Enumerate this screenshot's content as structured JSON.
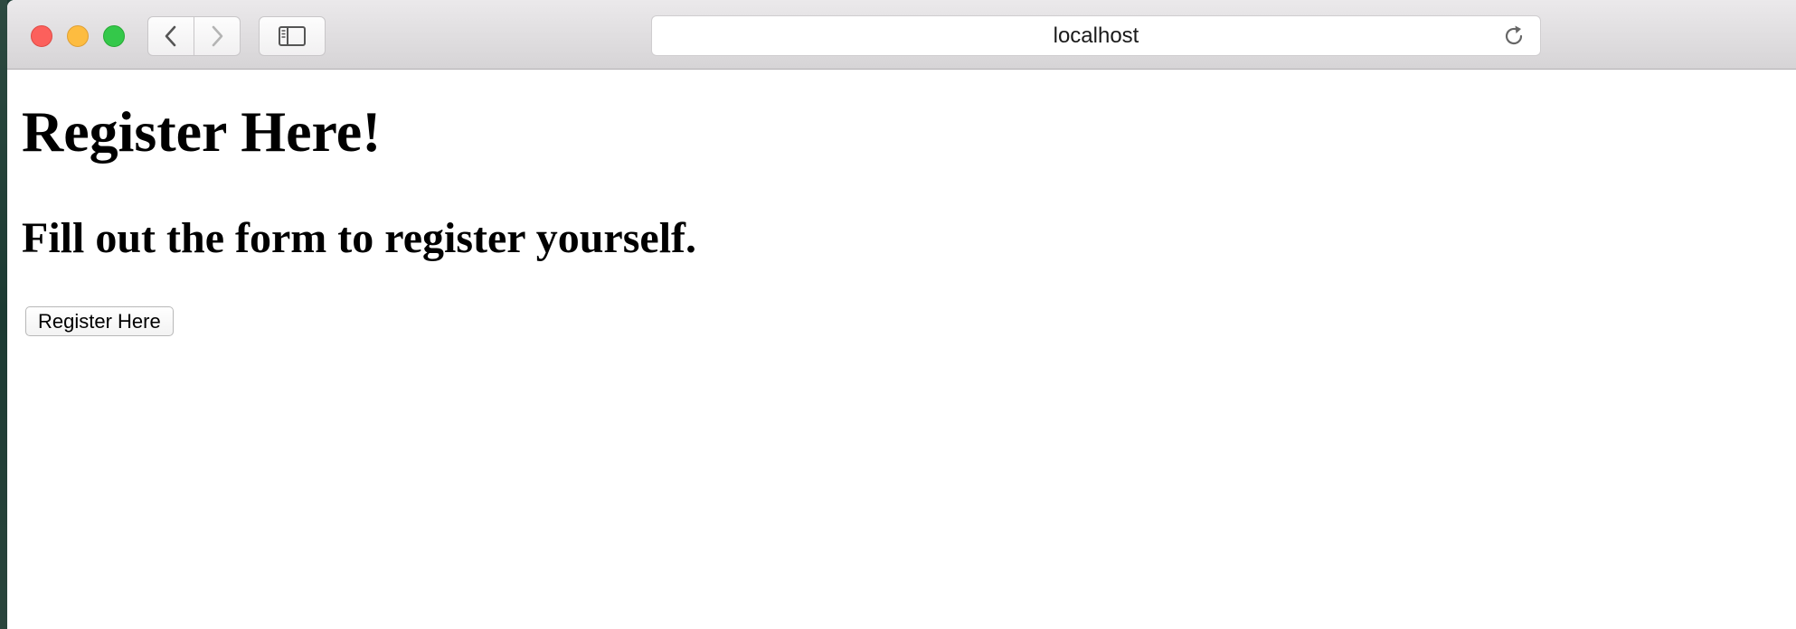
{
  "browser": {
    "address": "localhost",
    "icons": {
      "back": "chevron-left-icon",
      "forward": "chevron-right-icon",
      "sidebar": "sidebar-icon",
      "reload": "reload-icon"
    }
  },
  "page": {
    "heading": "Register Here!",
    "subheading": "Fill out the form to register yourself.",
    "register_button_label": "Register Here"
  },
  "colors": {
    "close": "#fc605c",
    "minimize": "#fdbc40",
    "maximize": "#34c84a"
  }
}
